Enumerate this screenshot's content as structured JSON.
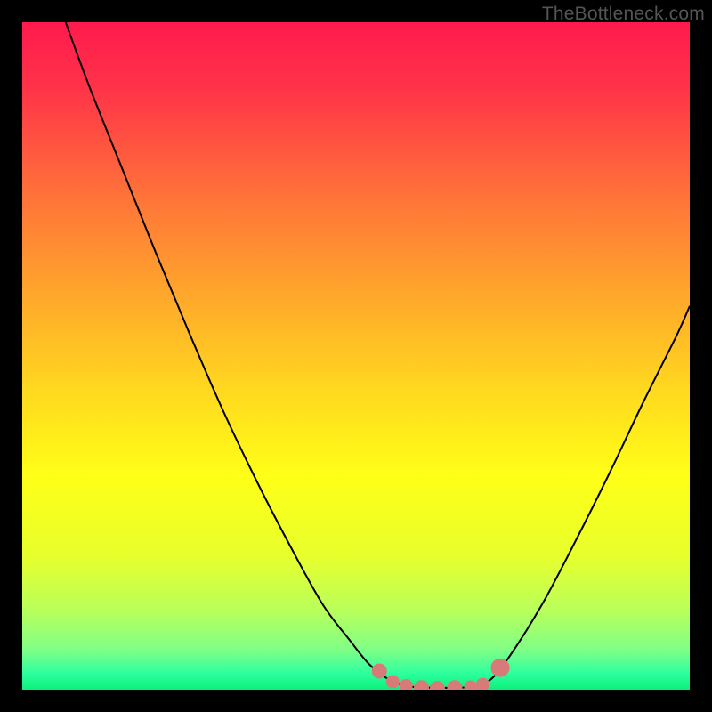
{
  "watermark": "TheBottleneck.com",
  "colors": {
    "frame": "#000000",
    "gradient_stops": [
      {
        "offset": 0.0,
        "color": "#ff1a4d"
      },
      {
        "offset": 0.1,
        "color": "#ff3348"
      },
      {
        "offset": 0.25,
        "color": "#ff6f3a"
      },
      {
        "offset": 0.4,
        "color": "#ffa42c"
      },
      {
        "offset": 0.55,
        "color": "#ffd81f"
      },
      {
        "offset": 0.68,
        "color": "#ffff17"
      },
      {
        "offset": 0.8,
        "color": "#e7ff2c"
      },
      {
        "offset": 0.88,
        "color": "#baff5a"
      },
      {
        "offset": 0.94,
        "color": "#80ff86"
      },
      {
        "offset": 0.975,
        "color": "#2dff9f"
      },
      {
        "offset": 1.0,
        "color": "#0cf07a"
      }
    ],
    "curve_stroke": "#000000",
    "marker_fill": "#d87b78",
    "marker_stroke": "#d87b78"
  },
  "chart_data": {
    "type": "line",
    "title": "",
    "xlabel": "",
    "ylabel": "",
    "xlim": [
      0,
      1
    ],
    "ylim": [
      0,
      1
    ],
    "series": [
      {
        "name": "curve",
        "points": [
          {
            "x": 0.065,
            "y": 1.0
          },
          {
            "x": 0.1,
            "y": 0.905
          },
          {
            "x": 0.15,
            "y": 0.78
          },
          {
            "x": 0.2,
            "y": 0.655
          },
          {
            "x": 0.25,
            "y": 0.535
          },
          {
            "x": 0.3,
            "y": 0.42
          },
          {
            "x": 0.35,
            "y": 0.315
          },
          {
            "x": 0.4,
            "y": 0.218
          },
          {
            "x": 0.45,
            "y": 0.128
          },
          {
            "x": 0.49,
            "y": 0.075
          },
          {
            "x": 0.52,
            "y": 0.038
          },
          {
            "x": 0.55,
            "y": 0.015
          },
          {
            "x": 0.58,
            "y": 0.005
          },
          {
            "x": 0.62,
            "y": 0.003
          },
          {
            "x": 0.67,
            "y": 0.004
          },
          {
            "x": 0.7,
            "y": 0.014
          },
          {
            "x": 0.73,
            "y": 0.05
          },
          {
            "x": 0.78,
            "y": 0.13
          },
          {
            "x": 0.83,
            "y": 0.225
          },
          {
            "x": 0.88,
            "y": 0.325
          },
          {
            "x": 0.93,
            "y": 0.43
          },
          {
            "x": 0.98,
            "y": 0.53
          },
          {
            "x": 1.0,
            "y": 0.575
          }
        ]
      }
    ],
    "markers": [
      {
        "x": 0.535,
        "y": 0.028,
        "r": 8
      },
      {
        "x": 0.555,
        "y": 0.012,
        "r": 7
      },
      {
        "x": 0.575,
        "y": 0.006,
        "r": 7
      },
      {
        "x": 0.598,
        "y": 0.003,
        "r": 8
      },
      {
        "x": 0.622,
        "y": 0.002,
        "r": 8
      },
      {
        "x": 0.648,
        "y": 0.003,
        "r": 8
      },
      {
        "x": 0.672,
        "y": 0.004,
        "r": 7
      },
      {
        "x": 0.69,
        "y": 0.008,
        "r": 7
      },
      {
        "x": 0.716,
        "y": 0.033,
        "r": 10
      }
    ]
  }
}
